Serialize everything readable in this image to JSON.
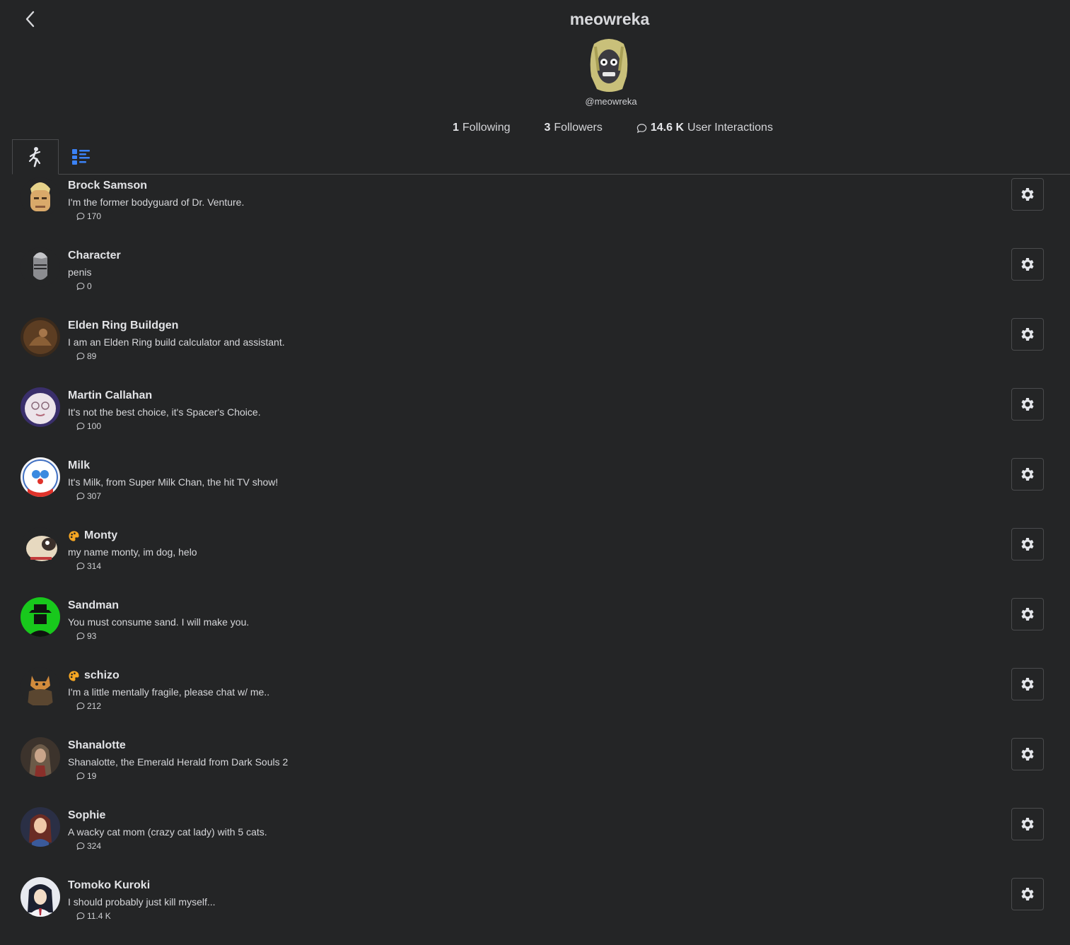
{
  "profile": {
    "title": "meowreka",
    "handle": "@meowreka"
  },
  "stats": {
    "following_count": "1",
    "following_label": "Following",
    "followers_count": "3",
    "followers_label": "Followers",
    "interactions_count": "14.6 K",
    "interactions_label": "User Interactions"
  },
  "tabs": [
    {
      "icon": "characters-tab-icon"
    },
    {
      "icon": "list-tab-icon"
    }
  ],
  "characters": [
    {
      "name": "Brock Samson",
      "description": "I'm the former bodyguard of Dr. Venture.",
      "count": "170",
      "badge": false
    },
    {
      "name": "Character",
      "description": "penis",
      "count": "0",
      "badge": false
    },
    {
      "name": "Elden Ring Buildgen",
      "description": "I am an Elden Ring build calculator and assistant.",
      "count": "89",
      "badge": false
    },
    {
      "name": "Martin Callahan",
      "description": "It's not the best choice, it's Spacer's Choice.",
      "count": "100",
      "badge": false
    },
    {
      "name": "Milk",
      "description": "It's Milk, from Super Milk Chan, the hit TV show!",
      "count": "307",
      "badge": false
    },
    {
      "name": "Monty",
      "description": "my name monty, im dog, helo",
      "count": "314",
      "badge": true
    },
    {
      "name": "Sandman",
      "description": "You must consume sand. I will make you.",
      "count": "93",
      "badge": false
    },
    {
      "name": "schizo",
      "description": "I'm a little mentally fragile, please chat w/ me..",
      "count": "212",
      "badge": true
    },
    {
      "name": "Shanalotte",
      "description": "Shanalotte, the Emerald Herald from Dark Souls 2",
      "count": "19",
      "badge": false
    },
    {
      "name": "Sophie",
      "description": "A wacky cat mom (crazy cat lady) with 5 cats.",
      "count": "324",
      "badge": false
    },
    {
      "name": "Tomoko Kuroki",
      "description": "I should probably just kill myself...",
      "count": "11.4 K",
      "badge": false
    }
  ],
  "colors": {
    "background": "#242526",
    "text": "#e4e6eb",
    "border": "#4a4b4d",
    "accent": "#3b82f6",
    "badge": "#f5a623"
  }
}
